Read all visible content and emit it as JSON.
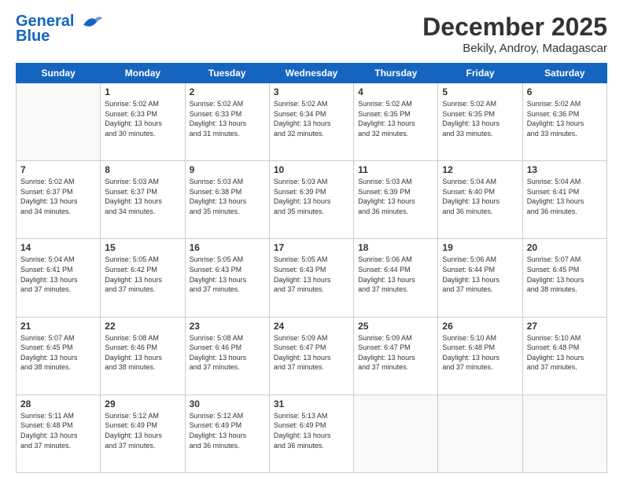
{
  "logo": {
    "line1": "General",
    "line2": "Blue"
  },
  "title": "December 2025",
  "location": "Bekily, Androy, Madagascar",
  "weekdays": [
    "Sunday",
    "Monday",
    "Tuesday",
    "Wednesday",
    "Thursday",
    "Friday",
    "Saturday"
  ],
  "weeks": [
    [
      {
        "day": "",
        "empty": true
      },
      {
        "day": "1",
        "sunrise": "5:02 AM",
        "sunset": "6:33 PM",
        "daylight": "13 hours and 30 minutes."
      },
      {
        "day": "2",
        "sunrise": "5:02 AM",
        "sunset": "6:33 PM",
        "daylight": "13 hours and 31 minutes."
      },
      {
        "day": "3",
        "sunrise": "5:02 AM",
        "sunset": "6:34 PM",
        "daylight": "13 hours and 32 minutes."
      },
      {
        "day": "4",
        "sunrise": "5:02 AM",
        "sunset": "6:35 PM",
        "daylight": "13 hours and 32 minutes."
      },
      {
        "day": "5",
        "sunrise": "5:02 AM",
        "sunset": "6:35 PM",
        "daylight": "13 hours and 33 minutes."
      },
      {
        "day": "6",
        "sunrise": "5:02 AM",
        "sunset": "6:36 PM",
        "daylight": "13 hours and 33 minutes."
      }
    ],
    [
      {
        "day": "7",
        "sunrise": "5:02 AM",
        "sunset": "6:37 PM",
        "daylight": "13 hours and 34 minutes."
      },
      {
        "day": "8",
        "sunrise": "5:03 AM",
        "sunset": "6:37 PM",
        "daylight": "13 hours and 34 minutes."
      },
      {
        "day": "9",
        "sunrise": "5:03 AM",
        "sunset": "6:38 PM",
        "daylight": "13 hours and 35 minutes."
      },
      {
        "day": "10",
        "sunrise": "5:03 AM",
        "sunset": "6:39 PM",
        "daylight": "13 hours and 35 minutes."
      },
      {
        "day": "11",
        "sunrise": "5:03 AM",
        "sunset": "6:39 PM",
        "daylight": "13 hours and 36 minutes."
      },
      {
        "day": "12",
        "sunrise": "5:04 AM",
        "sunset": "6:40 PM",
        "daylight": "13 hours and 36 minutes."
      },
      {
        "day": "13",
        "sunrise": "5:04 AM",
        "sunset": "6:41 PM",
        "daylight": "13 hours and 36 minutes."
      }
    ],
    [
      {
        "day": "14",
        "sunrise": "5:04 AM",
        "sunset": "6:41 PM",
        "daylight": "13 hours and 37 minutes."
      },
      {
        "day": "15",
        "sunrise": "5:05 AM",
        "sunset": "6:42 PM",
        "daylight": "13 hours and 37 minutes."
      },
      {
        "day": "16",
        "sunrise": "5:05 AM",
        "sunset": "6:43 PM",
        "daylight": "13 hours and 37 minutes."
      },
      {
        "day": "17",
        "sunrise": "5:05 AM",
        "sunset": "6:43 PM",
        "daylight": "13 hours and 37 minutes."
      },
      {
        "day": "18",
        "sunrise": "5:06 AM",
        "sunset": "6:44 PM",
        "daylight": "13 hours and 37 minutes."
      },
      {
        "day": "19",
        "sunrise": "5:06 AM",
        "sunset": "6:44 PM",
        "daylight": "13 hours and 37 minutes."
      },
      {
        "day": "20",
        "sunrise": "5:07 AM",
        "sunset": "6:45 PM",
        "daylight": "13 hours and 38 minutes."
      }
    ],
    [
      {
        "day": "21",
        "sunrise": "5:07 AM",
        "sunset": "6:45 PM",
        "daylight": "13 hours and 38 minutes."
      },
      {
        "day": "22",
        "sunrise": "5:08 AM",
        "sunset": "6:46 PM",
        "daylight": "13 hours and 38 minutes."
      },
      {
        "day": "23",
        "sunrise": "5:08 AM",
        "sunset": "6:46 PM",
        "daylight": "13 hours and 37 minutes."
      },
      {
        "day": "24",
        "sunrise": "5:09 AM",
        "sunset": "6:47 PM",
        "daylight": "13 hours and 37 minutes."
      },
      {
        "day": "25",
        "sunrise": "5:09 AM",
        "sunset": "6:47 PM",
        "daylight": "13 hours and 37 minutes."
      },
      {
        "day": "26",
        "sunrise": "5:10 AM",
        "sunset": "6:48 PM",
        "daylight": "13 hours and 37 minutes."
      },
      {
        "day": "27",
        "sunrise": "5:10 AM",
        "sunset": "6:48 PM",
        "daylight": "13 hours and 37 minutes."
      }
    ],
    [
      {
        "day": "28",
        "sunrise": "5:11 AM",
        "sunset": "6:48 PM",
        "daylight": "13 hours and 37 minutes."
      },
      {
        "day": "29",
        "sunrise": "5:12 AM",
        "sunset": "6:49 PM",
        "daylight": "13 hours and 37 minutes."
      },
      {
        "day": "30",
        "sunrise": "5:12 AM",
        "sunset": "6:49 PM",
        "daylight": "13 hours and 36 minutes."
      },
      {
        "day": "31",
        "sunrise": "5:13 AM",
        "sunset": "6:49 PM",
        "daylight": "13 hours and 36 minutes."
      },
      {
        "day": "",
        "empty": true
      },
      {
        "day": "",
        "empty": true
      },
      {
        "day": "",
        "empty": true
      }
    ]
  ]
}
